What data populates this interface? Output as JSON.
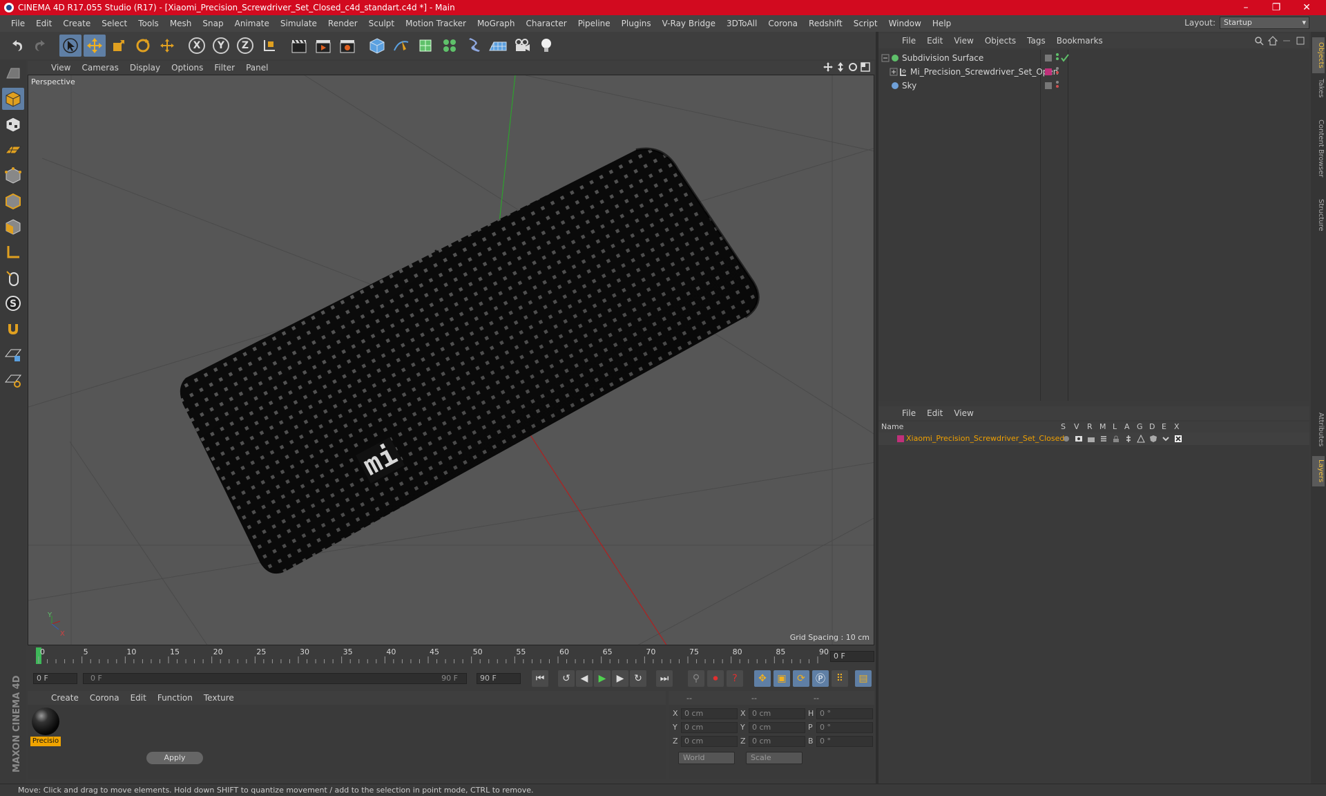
{
  "window": {
    "title": "CINEMA 4D R17.055 Studio (R17) - [Xiaomi_Precision_Screwdriver_Set_Closed_c4d_standart.c4d *] - Main",
    "minimize": "–",
    "maximize": "❐",
    "close": "✕"
  },
  "menu": [
    "File",
    "Edit",
    "Create",
    "Select",
    "Tools",
    "Mesh",
    "Snap",
    "Animate",
    "Simulate",
    "Render",
    "Sculpt",
    "Motion Tracker",
    "MoGraph",
    "Character",
    "Pipeline",
    "Plugins",
    "V-Ray Bridge",
    "3DToAll",
    "Corona",
    "Redshift",
    "Script",
    "Window",
    "Help"
  ],
  "layout": {
    "label": "Layout:",
    "value": "Startup"
  },
  "toolbar": {
    "axis_x": "X",
    "axis_y": "Y",
    "axis_z": "Z"
  },
  "viewport": {
    "menu": [
      "View",
      "Cameras",
      "Display",
      "Options",
      "Filter",
      "Panel"
    ],
    "label": "Perspective",
    "grid_spacing": "Grid Spacing : 10 cm",
    "logo_text": "mi",
    "axis_y": "Y",
    "axis_x": "X"
  },
  "timeline": {
    "ticks": [
      "0",
      "5",
      "10",
      "15",
      "20",
      "25",
      "30",
      "35",
      "40",
      "45",
      "50",
      "55",
      "60",
      "65",
      "70",
      "75",
      "80",
      "85",
      "90"
    ],
    "current_frame": "0 F",
    "start_field": "0 F",
    "range_start": "0 F",
    "range_end": "90 F",
    "end_field": "90 F"
  },
  "material_manager": {
    "menu": [
      "Create",
      "Corona",
      "Edit",
      "Function",
      "Texture"
    ],
    "material_name": "Precisio"
  },
  "coordinates": {
    "headers": [
      "--",
      "--",
      "--"
    ],
    "rows": [
      {
        "l1": "X",
        "v1": "0 cm",
        "l2": "X",
        "v2": "0 cm",
        "l3": "H",
        "v3": "0 °"
      },
      {
        "l1": "Y",
        "v1": "0 cm",
        "l2": "Y",
        "v2": "0 cm",
        "l3": "P",
        "v3": "0 °"
      },
      {
        "l1": "Z",
        "v1": "0 cm",
        "l2": "Z",
        "v2": "0 cm",
        "l3": "B",
        "v3": "0 °"
      }
    ],
    "mode_world": "World",
    "mode_scale": "Scale",
    "apply": "Apply"
  },
  "object_manager": {
    "menu": [
      "File",
      "Edit",
      "View",
      "Objects",
      "Tags",
      "Bookmarks"
    ],
    "objects": [
      {
        "name": "Subdivision Surface",
        "icon_color": "#5fc06a"
      },
      {
        "name": "Mi_Precision_Screwdriver_Set_Open",
        "icon_color": "#d0d0d0",
        "tag_color": "#c0307a"
      },
      {
        "name": "Sky",
        "icon_color": "#6fa0d8"
      }
    ]
  },
  "layer_manager": {
    "menu": [
      "File",
      "Edit",
      "View"
    ],
    "columns": [
      "Name",
      "S",
      "V",
      "R",
      "M",
      "L",
      "A",
      "G",
      "D",
      "E",
      "X"
    ],
    "layers": [
      {
        "name": "Xiaomi_Precision_Screwdriver_Set_Closed",
        "color": "#c0307a"
      }
    ]
  },
  "right_tabs": [
    "Objects",
    "Takes",
    "Content Browser",
    "Structure",
    "Attributes",
    "Layers"
  ],
  "branding": "MAXON CINEMA 4D",
  "status": "Move: Click and drag to move elements. Hold down SHIFT to quantize movement / add to the selection in point mode, CTRL to remove.",
  "colors": {
    "title_bar": "#d20a1f",
    "active_tool": "#5f7fa5",
    "material_label": "#f0a400",
    "layer_name": "#f0a000"
  }
}
